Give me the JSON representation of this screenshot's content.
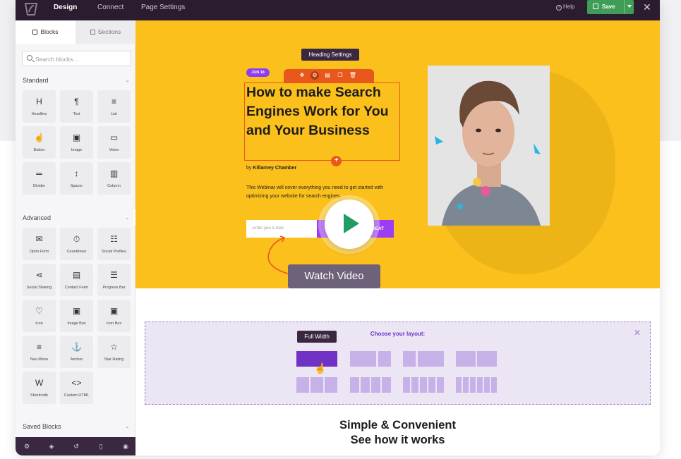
{
  "topbar": {
    "tabs": [
      "Design",
      "Connect",
      "Page Settings"
    ],
    "help": "Help",
    "save": "Save"
  },
  "sidebar": {
    "tabs": [
      "Blocks",
      "Sections"
    ],
    "search_placeholder": "Search blocks...",
    "standard_title": "Standard",
    "standard": [
      {
        "label": "Headline",
        "icon": "H"
      },
      {
        "label": "Text",
        "icon": "¶"
      },
      {
        "label": "List",
        "icon": "≡"
      },
      {
        "label": "Button",
        "icon": "☝"
      },
      {
        "label": "Image",
        "icon": "▣"
      },
      {
        "label": "Video",
        "icon": "▭"
      },
      {
        "label": "Divider",
        "icon": "═"
      },
      {
        "label": "Spacer",
        "icon": "↕"
      },
      {
        "label": "Column",
        "icon": "▥"
      }
    ],
    "advanced_title": "Advanced",
    "advanced": [
      {
        "label": "Optin Form",
        "icon": "✉"
      },
      {
        "label": "Countdown",
        "icon": "⏱"
      },
      {
        "label": "Social Profiles",
        "icon": "☷"
      },
      {
        "label": "Social Sharing",
        "icon": "⋖"
      },
      {
        "label": "Contact Form",
        "icon": "▤"
      },
      {
        "label": "Progress Bar",
        "icon": "☰"
      },
      {
        "label": "Icon",
        "icon": "♡"
      },
      {
        "label": "Image Box",
        "icon": "▣"
      },
      {
        "label": "Icon Box",
        "icon": "▣"
      },
      {
        "label": "Nav Menu",
        "icon": "≡"
      },
      {
        "label": "Anchor",
        "icon": "⚓"
      },
      {
        "label": "Star Rating",
        "icon": "☆"
      },
      {
        "label": "Shortcode",
        "icon": "W"
      },
      {
        "label": "Custom HTML",
        "icon": "<>"
      }
    ],
    "saved_title": "Saved Blocks"
  },
  "hero": {
    "tooltip": "Heading Settings",
    "date": "JUN 18",
    "headline": "How to make Search Engines Work for You and Your Business",
    "by": "by ",
    "author": "Killarney Chamber",
    "description": "This Webinar will cover everything you need to get started with optimizing your website for search engines.",
    "email_placeholder": "Enter you e-mail",
    "reserve": "RESERVE MY SEAT",
    "watch_video": "Watch Video"
  },
  "layout": {
    "title": "Choose your layout:",
    "tooltip": "Full Width"
  },
  "footer": {
    "line1": "Simple & Convenient",
    "line2": "See how it works"
  },
  "colors": {
    "hero_bg": "#fbc01b",
    "accent_orange": "#e8581c",
    "purple": "#9c3df2",
    "topbar": "#2b1d2f",
    "save_green": "#3f9d58"
  }
}
